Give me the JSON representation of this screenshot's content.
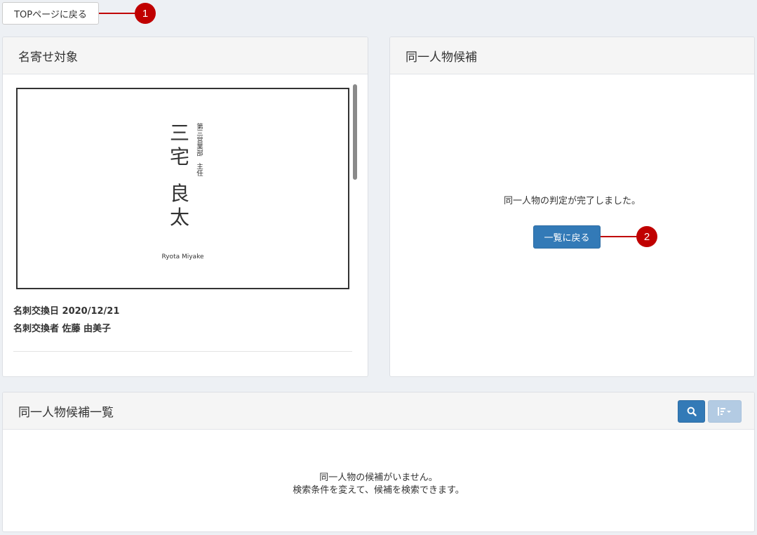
{
  "top_button": {
    "label": "TOPページに戻る"
  },
  "callouts": [
    "1",
    "2"
  ],
  "left_panel": {
    "title": "名寄せ対象",
    "card": {
      "name_line1": [
        "三",
        "宅"
      ],
      "name_line2": [
        "良",
        "太"
      ],
      "title_text": "第三営業部　主任",
      "romaji": "Ryota Miyake"
    },
    "meta": {
      "exchange_date": "名刺交換日 2020/12/21",
      "exchanger": "名刺交換者 佐藤 由美子"
    }
  },
  "right_panel": {
    "title": "同一人物候補",
    "message": "同一人物の判定が完了しました。",
    "back_button": "一覧に戻る"
  },
  "bottom_panel": {
    "title": "同一人物候補一覧",
    "empty_line1": "同一人物の候補がいません。",
    "empty_line2": "検索条件を変えて、候補を検索できます。",
    "tools": [
      "search-icon",
      "sort-icon"
    ]
  },
  "colors": {
    "primary": "#337ab7",
    "primary_disabled": "#b3cbe3",
    "callout": "#c00000",
    "background": "#edf0f4"
  }
}
